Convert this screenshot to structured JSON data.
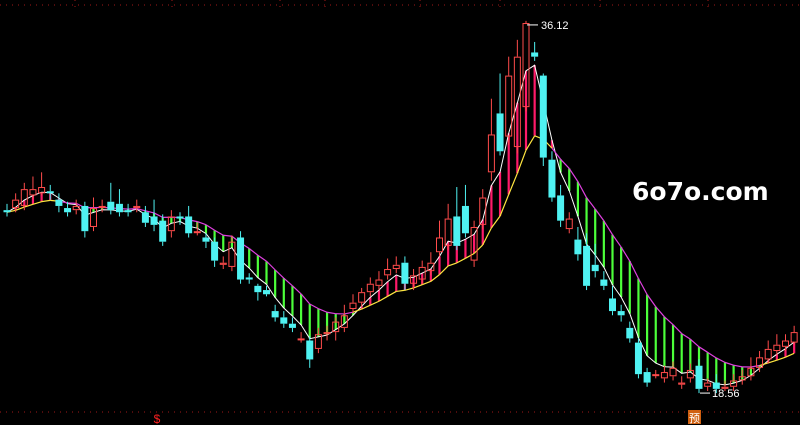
{
  "watermark": "6o7o.com",
  "chart_data": {
    "type": "candlestick",
    "ylim": [
      17.5,
      37.0
    ],
    "grid": true,
    "high_label": "36.12",
    "low_label": "18.56",
    "bottom_markers": [
      "$",
      "预"
    ],
    "colors": {
      "up": "#ff4b4b",
      "down": "#4ff2f2",
      "band_up": "#ff1a6a",
      "band_down": "#4cff3a",
      "fast_line": "#ffffff",
      "slow_line_up": "#ffe640",
      "slow_line_down": "#e040e0",
      "grid": "#a01818",
      "marker": "#ff2020"
    },
    "candles": [
      [
        27.1,
        27.0,
        27.4,
        26.8
      ],
      [
        27.2,
        27.6,
        27.9,
        27.0
      ],
      [
        27.3,
        28.1,
        28.4,
        27.1
      ],
      [
        27.8,
        28.1,
        28.7,
        27.6
      ],
      [
        27.9,
        28.2,
        28.9,
        27.8
      ],
      [
        28.0,
        27.9,
        28.3,
        27.6
      ],
      [
        27.6,
        27.3,
        27.9,
        27.0
      ],
      [
        27.2,
        27.0,
        27.5,
        26.8
      ],
      [
        27.1,
        27.3,
        27.6,
        26.9
      ],
      [
        27.3,
        26.1,
        27.5,
        25.8
      ],
      [
        26.3,
        27.2,
        27.7,
        26.1
      ],
      [
        27.3,
        27.3,
        27.6,
        27.0
      ],
      [
        27.5,
        27.1,
        28.4,
        26.9
      ],
      [
        27.4,
        27.0,
        28.1,
        26.8
      ],
      [
        27.1,
        27.0,
        27.4,
        26.8
      ],
      [
        27.2,
        27.3,
        27.6,
        27.0
      ],
      [
        27.0,
        26.5,
        27.3,
        26.3
      ],
      [
        26.8,
        26.4,
        27.6,
        26.1
      ],
      [
        26.6,
        25.6,
        26.9,
        25.4
      ],
      [
        26.1,
        26.8,
        27.1,
        25.8
      ],
      [
        26.8,
        26.7,
        27.0,
        26.4
      ],
      [
        26.8,
        26.0,
        27.3,
        25.8
      ],
      [
        26.1,
        26.1,
        26.5,
        25.9
      ],
      [
        25.8,
        25.6,
        26.0,
        25.3
      ],
      [
        25.6,
        24.7,
        25.8,
        24.4
      ],
      [
        24.5,
        24.6,
        24.9,
        24.3
      ],
      [
        24.4,
        25.6,
        25.9,
        24.2
      ],
      [
        25.8,
        23.8,
        26.1,
        23.6
      ],
      [
        23.9,
        23.8,
        24.1,
        23.6
      ],
      [
        23.5,
        23.2,
        23.6,
        22.8
      ],
      [
        23.3,
        23.1,
        23.5,
        23.0
      ],
      [
        22.3,
        22.0,
        22.6,
        21.8
      ],
      [
        22.0,
        21.7,
        22.3,
        21.5
      ],
      [
        21.7,
        21.5,
        22.0,
        21.3
      ],
      [
        21.0,
        21.0,
        21.3,
        20.8
      ],
      [
        20.9,
        20.0,
        21.1,
        19.6
      ],
      [
        20.5,
        21.2,
        21.5,
        20.3
      ],
      [
        21.2,
        21.3,
        21.6,
        20.9
      ],
      [
        21.3,
        21.8,
        22.0,
        20.9
      ],
      [
        21.5,
        22.1,
        22.6,
        21.3
      ],
      [
        22.4,
        22.7,
        23.1,
        22.2
      ],
      [
        22.7,
        23.2,
        23.4,
        22.5
      ],
      [
        23.2,
        23.6,
        23.9,
        23.0
      ],
      [
        23.5,
        23.8,
        24.2,
        23.3
      ],
      [
        24.0,
        24.3,
        24.8,
        23.8
      ],
      [
        24.3,
        24.5,
        24.9,
        24.1
      ],
      [
        24.6,
        23.6,
        24.9,
        23.3
      ],
      [
        23.6,
        24.0,
        24.3,
        23.3
      ],
      [
        23.8,
        24.4,
        24.7,
        23.6
      ],
      [
        24.2,
        24.6,
        25.1,
        24.0
      ],
      [
        25.1,
        25.8,
        26.6,
        24.9
      ],
      [
        25.4,
        26.7,
        27.4,
        25.2
      ],
      [
        26.8,
        25.4,
        28.2,
        25.2
      ],
      [
        27.3,
        26.0,
        28.3,
        25.8
      ],
      [
        24.7,
        26.3,
        26.6,
        24.4
      ],
      [
        26.4,
        27.7,
        28.1,
        26.2
      ],
      [
        28.9,
        30.7,
        32.4,
        28.5
      ],
      [
        31.7,
        29.9,
        33.6,
        29.7
      ],
      [
        30.6,
        33.5,
        34.4,
        30.2
      ],
      [
        30.1,
        34.4,
        35.2,
        29.8
      ],
      [
        32.0,
        36.0,
        36.1,
        31.8
      ],
      [
        34.6,
        34.4,
        35.1,
        34.2
      ],
      [
        33.5,
        29.6,
        33.6,
        29.2
      ],
      [
        29.5,
        27.7,
        29.9,
        27.5
      ],
      [
        27.8,
        26.6,
        28.3,
        26.3
      ],
      [
        26.2,
        26.7,
        27.0,
        26.0
      ],
      [
        25.7,
        25.0,
        26.3,
        24.7
      ],
      [
        25.4,
        23.5,
        26.0,
        23.3
      ],
      [
        24.5,
        24.2,
        25.5,
        23.9
      ],
      [
        23.8,
        23.5,
        24.2,
        23.3
      ],
      [
        22.9,
        22.3,
        23.5,
        22.1
      ],
      [
        22.3,
        22.1,
        22.6,
        21.8
      ],
      [
        21.5,
        21.0,
        21.8,
        20.8
      ],
      [
        20.8,
        19.3,
        21.0,
        19.1
      ],
      [
        19.4,
        18.9,
        19.6,
        18.7
      ],
      [
        19.3,
        19.3,
        19.5,
        19.1
      ],
      [
        19.1,
        19.4,
        19.7,
        18.9
      ],
      [
        19.2,
        19.6,
        19.9,
        19.0
      ],
      [
        18.8,
        18.9,
        19.2,
        18.6
      ],
      [
        19.1,
        19.5,
        19.8,
        18.9
      ],
      [
        19.7,
        18.6,
        20.0,
        18.4
      ],
      [
        18.7,
        18.9,
        19.1,
        18.5
      ],
      [
        18.9,
        18.6,
        19.3,
        18.4
      ],
      [
        18.6,
        18.7,
        19.0,
        18.5
      ],
      [
        18.7,
        19.0,
        19.3,
        18.5
      ],
      [
        19.0,
        19.2,
        19.5,
        18.8
      ],
      [
        19.2,
        19.6,
        20.1,
        19.0
      ],
      [
        19.6,
        20.1,
        20.4,
        19.4
      ],
      [
        20.0,
        20.5,
        20.9,
        19.8
      ],
      [
        20.4,
        20.7,
        21.2,
        20.2
      ],
      [
        20.6,
        20.9,
        21.2,
        20.4
      ],
      [
        20.8,
        21.3,
        21.6,
        20.7
      ]
    ]
  }
}
